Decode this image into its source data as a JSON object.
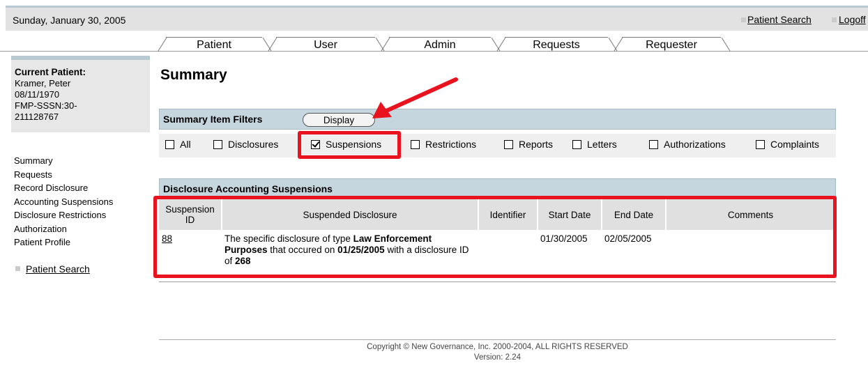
{
  "topbar": {
    "date": "Sunday, January 30, 2005",
    "links": [
      "Patient Search",
      "Logoff"
    ]
  },
  "tabs": [
    "Patient",
    "User",
    "Admin",
    "Requests",
    "Requester"
  ],
  "current_patient": {
    "heading": "Current Patient:",
    "name": "Kramer, Peter",
    "dob": "08/11/1970",
    "id_line1": "FMP-SSSN:30-",
    "id_line2": "211128767"
  },
  "left_nav": [
    "Summary",
    "Requests",
    "Record Disclosure",
    "Accounting Suspensions",
    "Disclosure Restrictions",
    "Authorization",
    "Patient Profile"
  ],
  "side_search": "Patient Search",
  "page_title": "Summary",
  "filters": {
    "title": "Summary Item Filters",
    "display_button": "Display",
    "items": [
      {
        "label": "All",
        "checked": false
      },
      {
        "label": "Disclosures",
        "checked": false
      },
      {
        "label": "Suspensions",
        "checked": true
      },
      {
        "label": "Restrictions",
        "checked": false
      },
      {
        "label": "Reports",
        "checked": false
      },
      {
        "label": "Letters",
        "checked": false
      },
      {
        "label": "Authorizations",
        "checked": false
      },
      {
        "label": "Complaints",
        "checked": false
      }
    ]
  },
  "suspensions": {
    "title": "Disclosure Accounting Suspensions",
    "columns": [
      "Suspension ID",
      "Suspended Disclosure",
      "Identifier",
      "Start Date",
      "End Date",
      "Comments"
    ],
    "rows": [
      {
        "id": "88",
        "desc_prefix": "The specific disclosure of type ",
        "desc_type": "Law Enforcement Purposes",
        "desc_mid": " that occured on ",
        "desc_date": "01/25/2005",
        "desc_mid2": " with a disclosure ID of ",
        "desc_disclosure_id": "268",
        "identifier": "",
        "start_date": "01/30/2005",
        "end_date": "02/05/2005",
        "comments": ""
      }
    ]
  },
  "footer": {
    "copyright": "Copyright © New Governance, Inc. 2000-2004, ALL RIGHTS RESERVED",
    "version": "Version: 2.24"
  },
  "colors": {
    "annotation_red": "#e8131e",
    "header_blue": "#c6d6df",
    "bar_gray": "#e2e2e2"
  }
}
